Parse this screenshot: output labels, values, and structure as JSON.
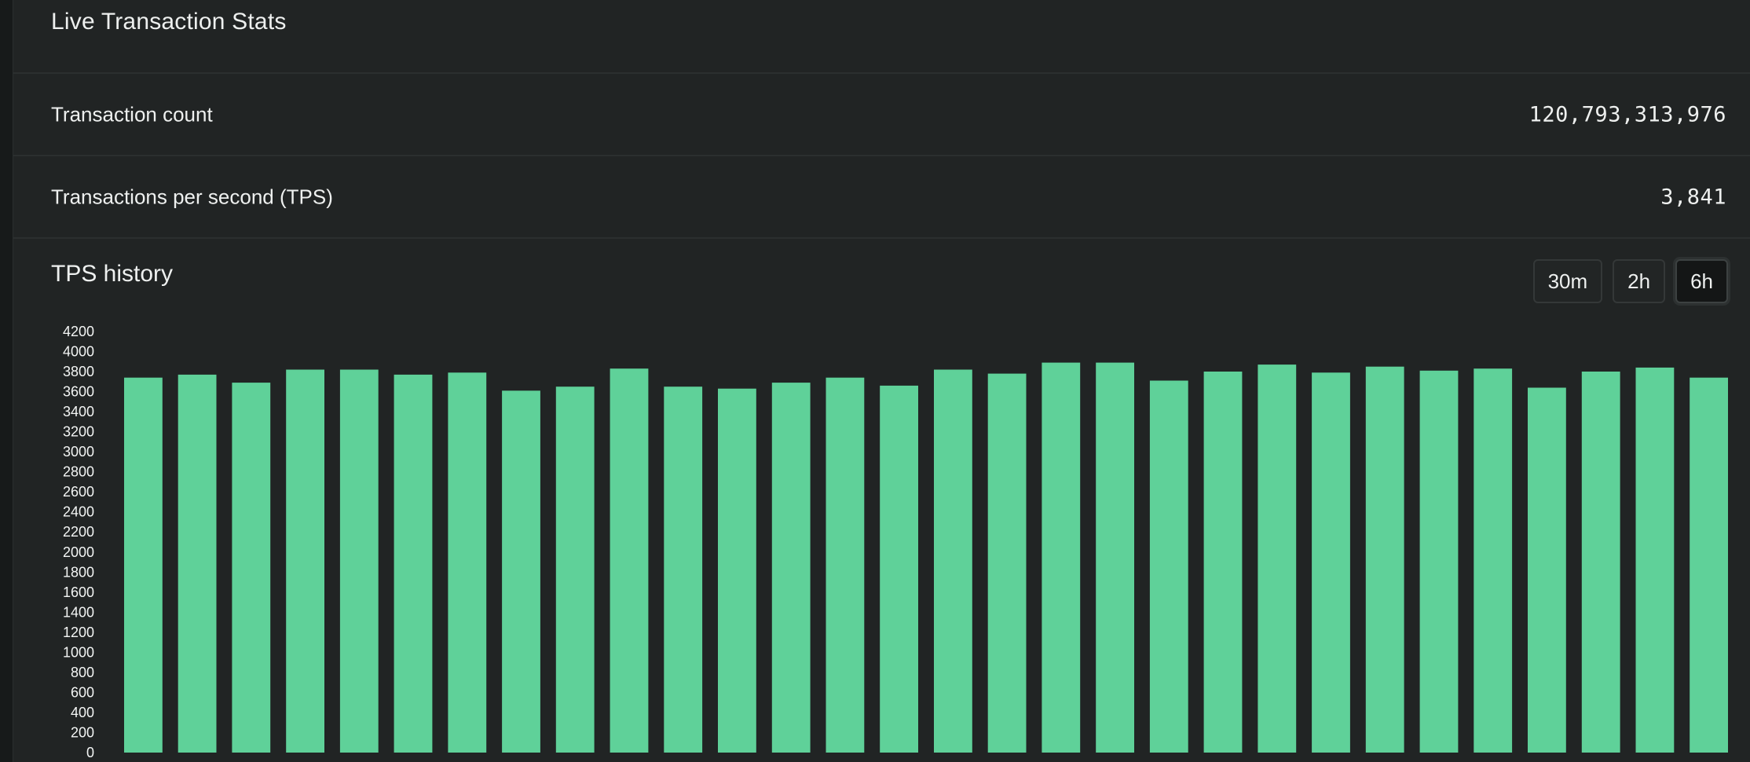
{
  "card": {
    "title": "Live Transaction Stats"
  },
  "stats": {
    "transaction_count_label": "Transaction count",
    "transaction_count_value": "120,793,313,976",
    "tps_label": "Transactions per second (TPS)",
    "tps_value": "3,841"
  },
  "history": {
    "title": "TPS history",
    "ranges": [
      "30m",
      "2h",
      "6h"
    ],
    "selected_range": "6h"
  },
  "colors": {
    "bar": "#5fd199",
    "background": "#212424"
  },
  "chart_data": {
    "type": "bar",
    "title": "TPS history",
    "xlabel": "",
    "ylabel": "",
    "ylim": [
      0,
      4200
    ],
    "yticks": [
      0,
      200,
      400,
      600,
      800,
      1000,
      1200,
      1400,
      1600,
      1800,
      2000,
      2200,
      2400,
      2600,
      2800,
      3000,
      3200,
      3400,
      3600,
      3800,
      4000,
      4200
    ],
    "grid": false,
    "values": [
      3740,
      3770,
      3690,
      3820,
      3820,
      3770,
      3790,
      3610,
      3650,
      3830,
      3650,
      3630,
      3690,
      3740,
      3660,
      3820,
      3780,
      3890,
      3890,
      3710,
      3800,
      3870,
      3790,
      3850,
      3810,
      3830,
      3640,
      3800,
      3840,
      3740
    ]
  }
}
